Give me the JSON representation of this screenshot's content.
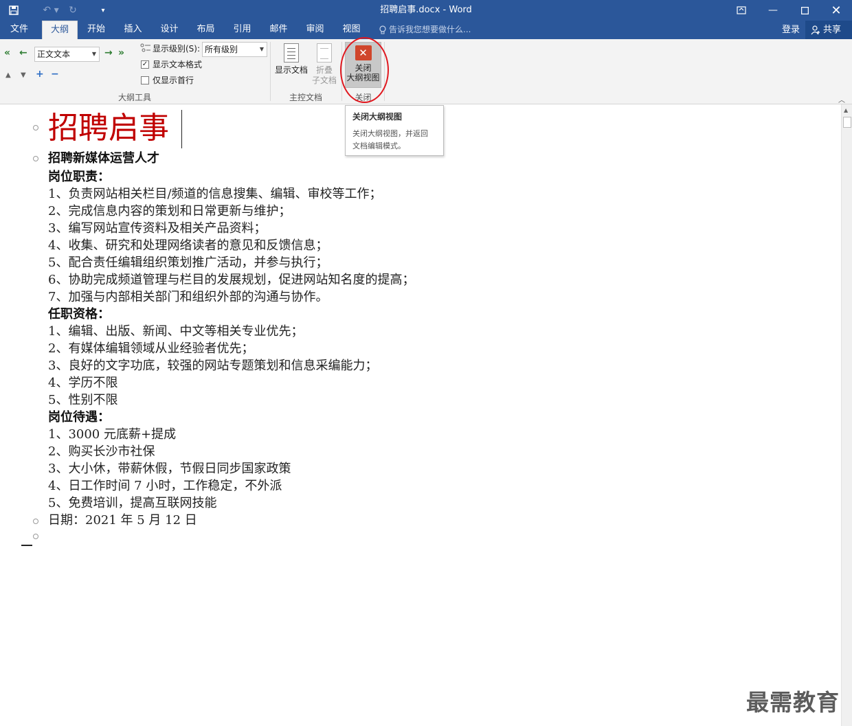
{
  "window": {
    "title": "招聘启事.docx - Word",
    "minimize_icon": "minimize-icon",
    "maximize_icon": "maximize-icon",
    "close_icon": "close-icon"
  },
  "quick_access": {
    "save_icon": "save-icon",
    "undo_icon": "undo-icon",
    "redo_icon": "redo-icon",
    "customize_icon": "customize-qat-icon"
  },
  "tabs": [
    {
      "label": "文件"
    },
    {
      "label": "大纲"
    },
    {
      "label": "开始"
    },
    {
      "label": "插入"
    },
    {
      "label": "设计"
    },
    {
      "label": "布局"
    },
    {
      "label": "引用"
    },
    {
      "label": "邮件"
    },
    {
      "label": "审阅"
    },
    {
      "label": "视图"
    }
  ],
  "active_tab": "大纲",
  "tell_me": "告诉我您想要做什么...",
  "login": "登录",
  "share": "共享",
  "ribbon": {
    "outline_tools": {
      "label": "大纲工具",
      "level_select": "正文文本",
      "show_level_label": "显示级别(S):",
      "show_level_value": "所有级别",
      "show_text_format": "显示文本格式",
      "show_text_format_checked": true,
      "show_first_line": "仅显示首行",
      "show_first_line_checked": false
    },
    "master_doc": {
      "label": "主控文档",
      "show_document": "显示文档",
      "collapse_subdocs_1": "折叠",
      "collapse_subdocs_2": "子文档"
    },
    "close": {
      "label": "关闭",
      "button_line1": "关闭",
      "button_line2": "大纲视图"
    }
  },
  "tooltip": {
    "title": "关闭大纲视图",
    "body_line1": "关闭大纲视图，并返回",
    "body_line2": "文档编辑模式。"
  },
  "document": {
    "title": "招聘启事",
    "subtitle": "招聘新媒体运营人才",
    "section1_heading": "岗位职责：",
    "section1_items": [
      "1、负责网站相关栏目/频道的信息搜集、编辑、审校等工作；",
      "2、完成信息内容的策划和日常更新与维护；",
      "3、编写网站宣传资料及相关产品资料；",
      "4、收集、研究和处理网络读者的意见和反馈信息；",
      "5、配合责任编辑组织策划推广活动，并参与执行；",
      "6、协助完成频道管理与栏目的发展规划，促进网站知名度的提高；",
      "7、加强与内部相关部门和组织外部的沟通与协作。"
    ],
    "section2_heading": "任职资格：",
    "section2_items": [
      "1、编辑、出版、新闻、中文等相关专业优先；",
      "2、有媒体编辑领域从业经验者优先；",
      "3、良好的文字功底，较强的网站专题策划和信息采编能力；",
      "4、学历不限",
      "5、性别不限"
    ],
    "section3_heading": "岗位待遇：",
    "section3_items": [
      "1、3000 元底薪+提成",
      "2、购买长沙市社保",
      "3、大小休，带薪休假，节假日同步国家政策",
      "4、日工作时间 7 小时，工作稳定，不外派",
      "5、免费培训，提高互联网技能"
    ],
    "date_line": "日期：2021 年 5 月 12 日"
  },
  "watermark": "最需教育"
}
